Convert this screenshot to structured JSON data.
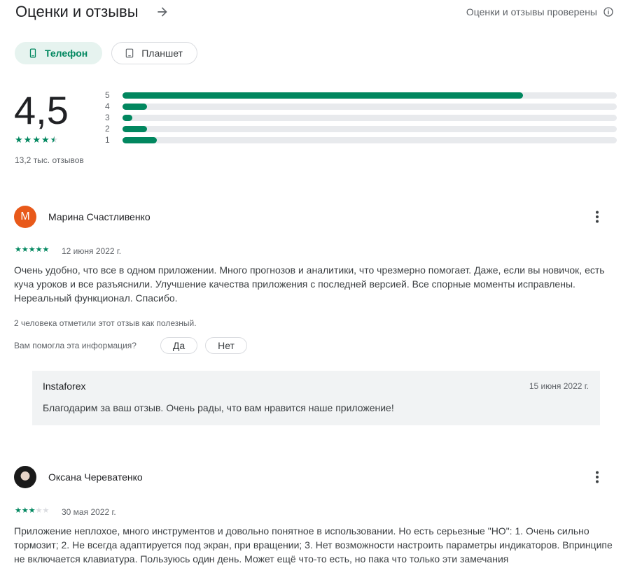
{
  "header": {
    "title": "Оценки и отзывы",
    "verified_label": "Оценки и отзывы проверены"
  },
  "device_tabs": [
    {
      "label": "Телефон",
      "icon": "phone-icon",
      "selected": true
    },
    {
      "label": "Планшет",
      "icon": "tablet-icon",
      "selected": false
    }
  ],
  "summary": {
    "rating": "4,5",
    "stars": 4.5,
    "reviews_count": "13,2 тыс. отзывов",
    "accent_color": "#01875f",
    "distribution": [
      {
        "label": "5",
        "fraction": 0.81
      },
      {
        "label": "4",
        "fraction": 0.05
      },
      {
        "label": "3",
        "fraction": 0.02
      },
      {
        "label": "2",
        "fraction": 0.05
      },
      {
        "label": "1",
        "fraction": 0.07
      }
    ]
  },
  "reviews": [
    {
      "author": "Марина Счастливенко",
      "avatar_letter": "М",
      "avatar_color": "#e8591a",
      "stars": 5,
      "date": "12 июня 2022 г.",
      "text": "Очень удобно, что все в одном приложении. Много прогнозов и аналитики, что чрезмерно помогает. Даже, если вы новичок, есть куча уроков и все разъяснили. Улучшение качества приложения с последней версией. Все спорные моменты исправлены. Нереальный функционал. Спасибо.",
      "helpful_text": "2 человека отметили этот отзыв как полезный.",
      "helpful_question": "Вам помогла эта информация?",
      "yes_label": "Да",
      "no_label": "Нет",
      "reply": {
        "author": "Instaforex",
        "date": "15 июня 2022 г.",
        "text": "Благодарим за ваш отзыв. Очень рады, что вам нравится наше приложение!"
      }
    },
    {
      "author": "Оксана Череватенко",
      "stars": 3,
      "date": "30 мая 2022 г.",
      "text": "Приложение неплохое, много инструментов и довольно понятное в использовании. Но есть серьезные \"НО\": 1. Очень сильно тормозит; 2. Не всегда адаптируется под экран, при вращении; 3. Нет возможности настроить параметры индикаторов. Впринципе не включается клавиатура. Пользуюсь один день. Может ещё что-то есть, но пака что только эти замечания"
    }
  ]
}
